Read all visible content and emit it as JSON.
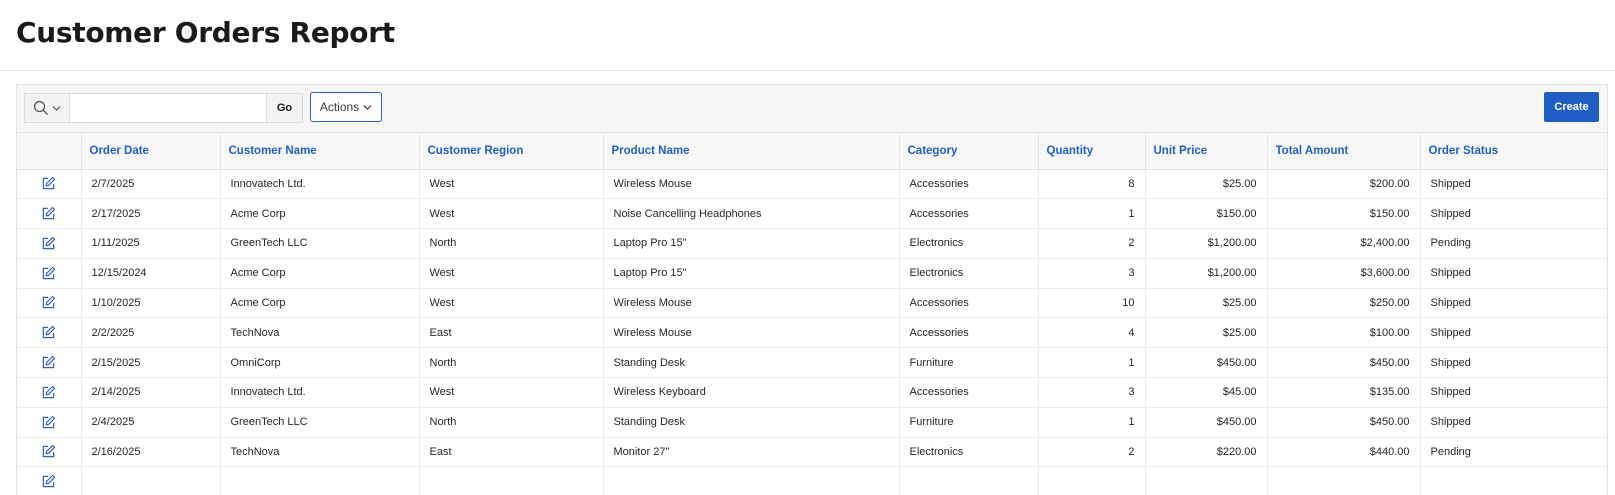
{
  "page": {
    "title": "Customer Orders Report"
  },
  "toolbar": {
    "search_value": "",
    "search_placeholder": "",
    "go_label": "Go",
    "actions_label": "Actions",
    "create_label": "Create"
  },
  "colors": {
    "accent": "#1f5fc5",
    "header_text": "#1f5fc5",
    "create_bg": "#1f5fc5"
  },
  "icons": {
    "search": "search-icon",
    "dropdown": "chevron-down-icon",
    "edit": "edit-icon"
  },
  "table": {
    "columns": [
      {
        "key": "edit",
        "label": ""
      },
      {
        "key": "order_date",
        "label": "Order Date"
      },
      {
        "key": "customer_name",
        "label": "Customer Name"
      },
      {
        "key": "customer_region",
        "label": "Customer Region"
      },
      {
        "key": "product_name",
        "label": "Product Name"
      },
      {
        "key": "category",
        "label": "Category"
      },
      {
        "key": "quantity",
        "label": "Quantity"
      },
      {
        "key": "unit_price",
        "label": "Unit Price"
      },
      {
        "key": "total_amount",
        "label": "Total Amount"
      },
      {
        "key": "order_status",
        "label": "Order Status"
      }
    ],
    "rows": [
      {
        "order_date": "2/7/2025",
        "customer_name": "Innovatech Ltd.",
        "customer_region": "West",
        "product_name": "Wireless Mouse",
        "category": "Accessories",
        "quantity": "8",
        "unit_price": "$25.00",
        "total_amount": "$200.00",
        "order_status": "Shipped"
      },
      {
        "order_date": "2/17/2025",
        "customer_name": "Acme Corp",
        "customer_region": "West",
        "product_name": "Noise Cancelling Headphones",
        "category": "Accessories",
        "quantity": "1",
        "unit_price": "$150.00",
        "total_amount": "$150.00",
        "order_status": "Shipped"
      },
      {
        "order_date": "1/11/2025",
        "customer_name": "GreenTech LLC",
        "customer_region": "North",
        "product_name": "Laptop Pro 15\"",
        "category": "Electronics",
        "quantity": "2",
        "unit_price": "$1,200.00",
        "total_amount": "$2,400.00",
        "order_status": "Pending"
      },
      {
        "order_date": "12/15/2024",
        "customer_name": "Acme Corp",
        "customer_region": "West",
        "product_name": "Laptop Pro 15\"",
        "category": "Electronics",
        "quantity": "3",
        "unit_price": "$1,200.00",
        "total_amount": "$3,600.00",
        "order_status": "Shipped"
      },
      {
        "order_date": "1/10/2025",
        "customer_name": "Acme Corp",
        "customer_region": "West",
        "product_name": "Wireless Mouse",
        "category": "Accessories",
        "quantity": "10",
        "unit_price": "$25.00",
        "total_amount": "$250.00",
        "order_status": "Shipped"
      },
      {
        "order_date": "2/2/2025",
        "customer_name": "TechNova",
        "customer_region": "East",
        "product_name": "Wireless Mouse",
        "category": "Accessories",
        "quantity": "4",
        "unit_price": "$25.00",
        "total_amount": "$100.00",
        "order_status": "Shipped"
      },
      {
        "order_date": "2/15/2025",
        "customer_name": "OmniCorp",
        "customer_region": "North",
        "product_name": "Standing Desk",
        "category": "Furniture",
        "quantity": "1",
        "unit_price": "$450.00",
        "total_amount": "$450.00",
        "order_status": "Shipped"
      },
      {
        "order_date": "2/14/2025",
        "customer_name": "Innovatech Ltd.",
        "customer_region": "West",
        "product_name": "Wireless Keyboard",
        "category": "Accessories",
        "quantity": "3",
        "unit_price": "$45.00",
        "total_amount": "$135.00",
        "order_status": "Shipped"
      },
      {
        "order_date": "2/4/2025",
        "customer_name": "GreenTech LLC",
        "customer_region": "North",
        "product_name": "Standing Desk",
        "category": "Furniture",
        "quantity": "1",
        "unit_price": "$450.00",
        "total_amount": "$450.00",
        "order_status": "Shipped"
      },
      {
        "order_date": "2/16/2025",
        "customer_name": "TechNova",
        "customer_region": "East",
        "product_name": "Monitor 27\"",
        "category": "Electronics",
        "quantity": "2",
        "unit_price": "$220.00",
        "total_amount": "$440.00",
        "order_status": "Pending"
      },
      {
        "order_date": "",
        "customer_name": "",
        "customer_region": "",
        "product_name": "",
        "category": "",
        "quantity": "",
        "unit_price": "",
        "total_amount": "",
        "order_status": ""
      }
    ]
  }
}
